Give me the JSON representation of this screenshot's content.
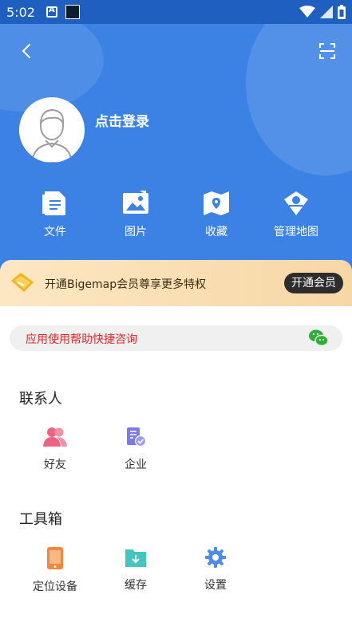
{
  "status_bar": {
    "time": "5:02"
  },
  "header": {
    "login_text": "点击登录",
    "quick_actions": [
      {
        "label": "文件",
        "icon": "file-icon"
      },
      {
        "label": "图片",
        "icon": "image-icon"
      },
      {
        "label": "收藏",
        "icon": "favorites-map-icon"
      },
      {
        "label": "管理地图",
        "icon": "manage-map-icon"
      }
    ]
  },
  "vip_banner": {
    "text": "开通Bigemap会员尊享更多特权",
    "button_label": "开通会员"
  },
  "help_bar": {
    "text": "应用使用帮助快捷咨询",
    "icon": "wechat-icon"
  },
  "contacts": {
    "title": "联系人",
    "items": [
      {
        "label": "好友",
        "icon": "friends-icon"
      },
      {
        "label": "企业",
        "icon": "enterprise-icon"
      }
    ]
  },
  "toolbox": {
    "title": "工具箱",
    "items": [
      {
        "label": "定位设备",
        "icon": "location-device-icon"
      },
      {
        "label": "缓存",
        "icon": "cache-icon"
      },
      {
        "label": "设置",
        "icon": "settings-gear-icon"
      }
    ]
  },
  "colors": {
    "header_blue": "#3b82e4",
    "help_text_red": "#e1282c",
    "vip_gradient_start": "#fde7c3",
    "vip_button_dark": "#2d2d2d"
  }
}
